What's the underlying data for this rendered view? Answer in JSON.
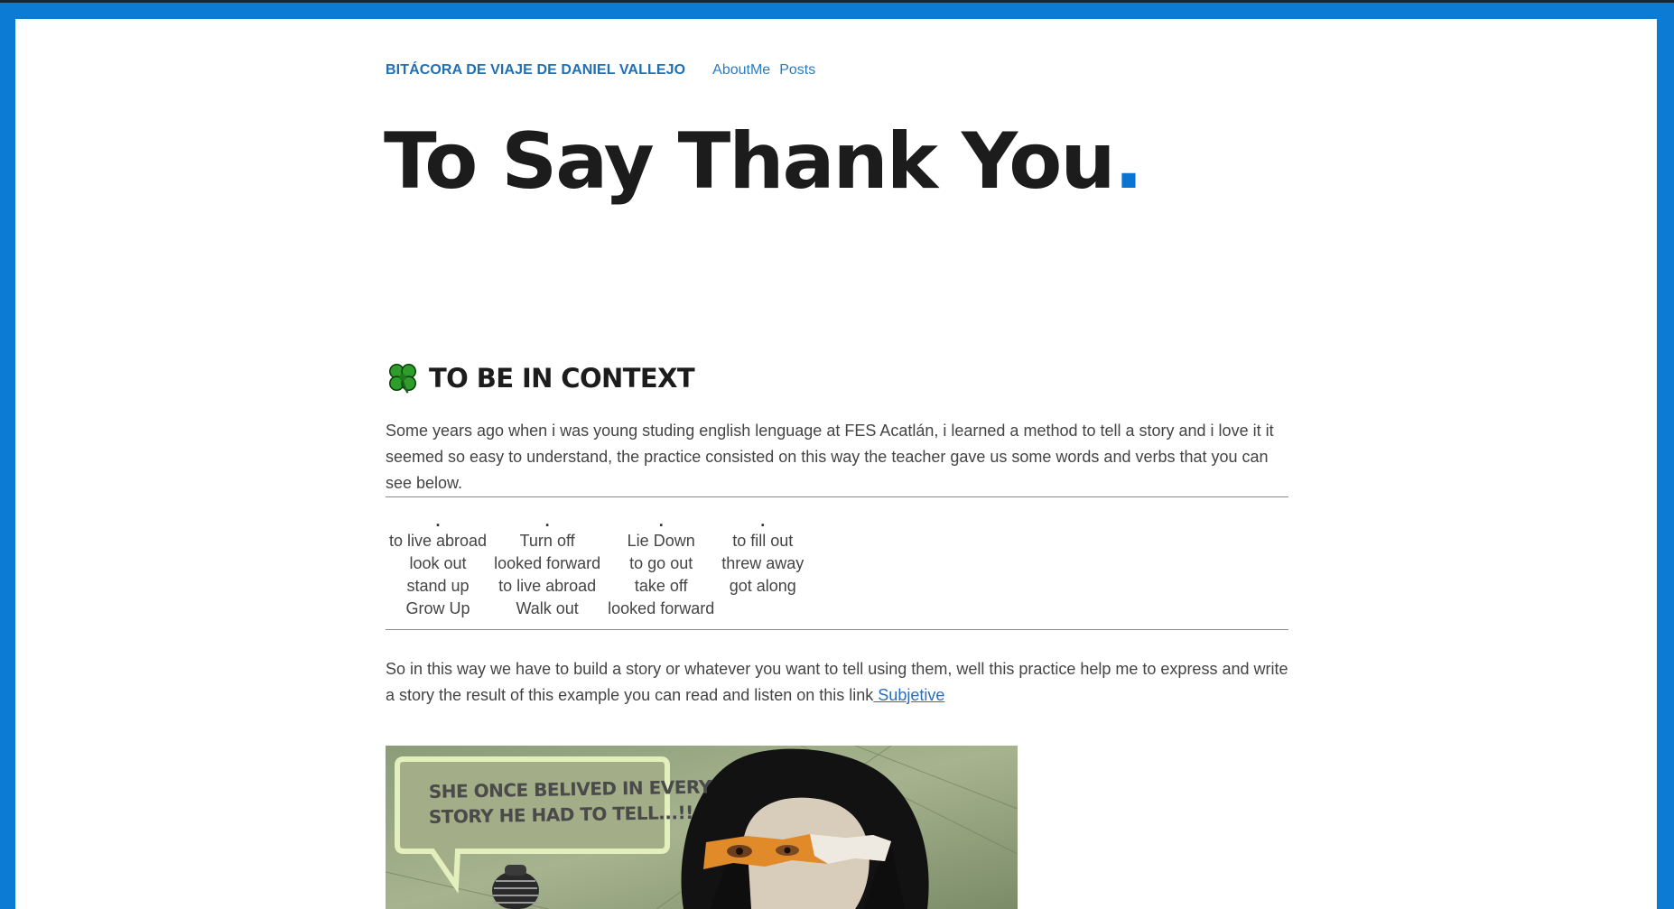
{
  "header": {
    "site_title": "BITÁCORA DE VIAJE DE DANIEL VALLEJO",
    "nav": [
      {
        "label": "AboutMe"
      },
      {
        "label": "Posts"
      }
    ]
  },
  "post": {
    "title": "To Say Thank You",
    "title_dot": "."
  },
  "section": {
    "icon": "four-leaf-clover-icon",
    "heading": "TO BE IN CONTEXT"
  },
  "intro_paragraph": "Some years ago when i was young studing english lenguage at FES Acatlán, i learned a method to tell a story and i love it it seemed so easy to understand, the practice consisted on this way the teacher gave us some words and verbs that you can see below.",
  "words_table": {
    "headers": [
      ".",
      ".",
      ".",
      "."
    ],
    "rows": [
      [
        "to live abroad",
        "Turn off",
        "Lie Down",
        "to fill out"
      ],
      [
        "look out",
        "looked forward",
        "to go out",
        "threw away"
      ],
      [
        "stand up",
        "to live abroad",
        "take off",
        "got along"
      ],
      [
        "Grow Up",
        "Walk out",
        "looked forward",
        ""
      ]
    ]
  },
  "closing_paragraph": {
    "text": "So in this way we have to build a story or whatever you want to tell using them, well this practice help me to express and write a story the result of this example you can read and listen on this link",
    "link_label": " Subjetive"
  },
  "illustration": {
    "speech_bubble_text_line1": "SHE ONCE BELIVED IN EVERY",
    "speech_bubble_text_line2": "STORY HE HAD TO TELL...!!"
  },
  "colors": {
    "frame": "#0b7bd3",
    "accent": "#0b73d1",
    "link": "#2a6fb7",
    "title_text": "#1c1c1c",
    "body_text": "#444444"
  }
}
